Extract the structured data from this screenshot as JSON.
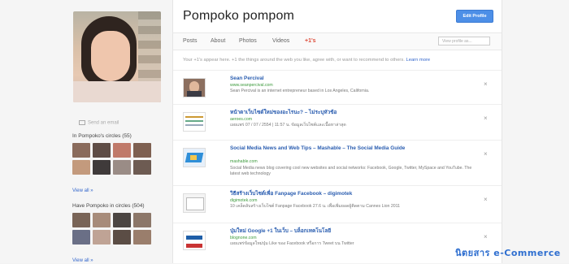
{
  "profile": {
    "name": "Pompoko pompom",
    "edit_label": "Edit Profile",
    "send_message": "Send an email"
  },
  "tabs": [
    {
      "label": "Posts"
    },
    {
      "label": "About"
    },
    {
      "label": "Photos"
    },
    {
      "label": "Videos"
    },
    {
      "label": "+1's"
    }
  ],
  "search": {
    "placeholder": "View profile as..."
  },
  "intro": {
    "text": "Your +1's appear here. +1 the things around the web you like, agree with, or want to recommend to others.",
    "learn_more": "Learn more"
  },
  "circles": {
    "in_title": "In Pompoko's circles (55)",
    "have_title": "Have Pompoko in circles (504)",
    "view_all": "View all »",
    "in_colors": [
      "#8a6b5c",
      "#5e4c45",
      "#c07a6a",
      "#7e6051",
      "#c39a7d",
      "#3f3a3a",
      "#9a8c86",
      "#6d5b52"
    ],
    "have_colors": [
      "#796457",
      "#a78b7a",
      "#4b4542",
      "#8c7769",
      "#6a6f86",
      "#bfa395",
      "#5b4d45",
      "#9a7e6c"
    ]
  },
  "items": [
    {
      "title": "Sean Percival",
      "url": "www.seanpercival.com",
      "desc": "Sean Percival is an internet entrepreneur based in Los Angeles, California.",
      "thumb": "person"
    },
    {
      "title": "หน้าตาเว็บไซต์ใหม่ของอะไรนะ? – ไม่ระบุหัวข้อ",
      "url": "aeroes.com",
      "desc": "เผยแพร่ 07 / 07 / 2554 | 11:57 น. ข้อมูลเว็บไซต์และเนื้อหาล่าสุด",
      "thumb": "table"
    },
    {
      "title": "Social Media News and Web Tips – Mashable – The Social Media Guide",
      "url": "mashable.com",
      "desc": "Social Media news blog covering cool new websites and social networks: Facebook, Google, Twitter, MySpace and YouTube. The latest web technology",
      "thumb": "mashable"
    },
    {
      "title": "วิธีสร้างเว็บไซต์เพื่อ Fanpage Facebook – digimotek",
      "url": "digimotek.com",
      "desc": "10 เคล็ดลับสร้างเว็บไซต์ Fanpage Facebook 27.6 น. เพื่อเพิ่มยอดผู้ติดตาม Cannes Lion 2011",
      "thumb": "blank"
    },
    {
      "title": "ปุ่มใหม่ Google +1 ในเว็บ – บล็อกเทคโนโลยี",
      "url": "blognone.com",
      "desc": "เผยแพร่ข้อมูลใหม่ปุ่ม Like ของ Facebook หรือการ Tweet บน Twitter",
      "thumb": "flag"
    }
  ],
  "watermark": "นิตยสาร e-Commerce"
}
